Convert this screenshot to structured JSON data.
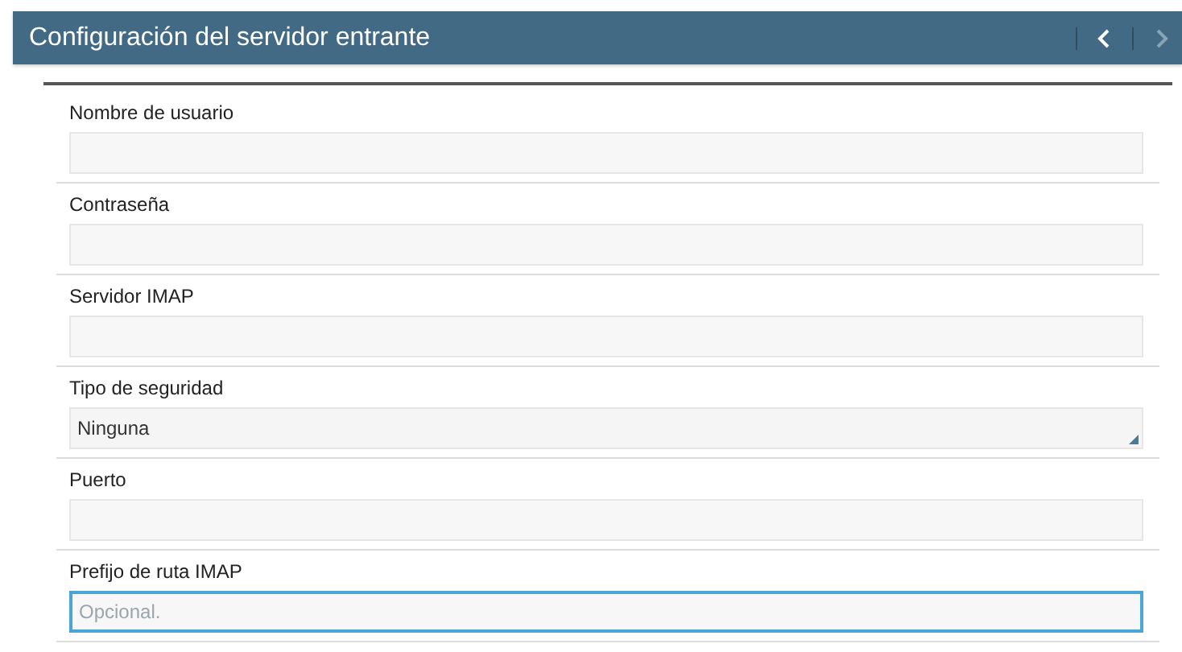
{
  "header": {
    "title": "Configuración del servidor entrante",
    "nav": [
      {
        "kind": "back",
        "disabled": false
      },
      {
        "kind": "forward",
        "disabled": true
      }
    ]
  },
  "fields": [
    {
      "kind": "text",
      "label": "Nombre de usuario",
      "focused": false
    },
    {
      "kind": "text",
      "label": "Contraseña",
      "focused": false
    },
    {
      "kind": "text",
      "label": "Servidor IMAP",
      "focused": false
    },
    {
      "kind": "select",
      "label": "Tipo de seguridad",
      "value": "Ninguna",
      "focused": false
    },
    {
      "kind": "text",
      "label": "Puerto",
      "focused": false
    },
    {
      "kind": "text",
      "label": "Prefijo de ruta IMAP",
      "placeholder": "Opcional.",
      "focused": true
    }
  ]
}
